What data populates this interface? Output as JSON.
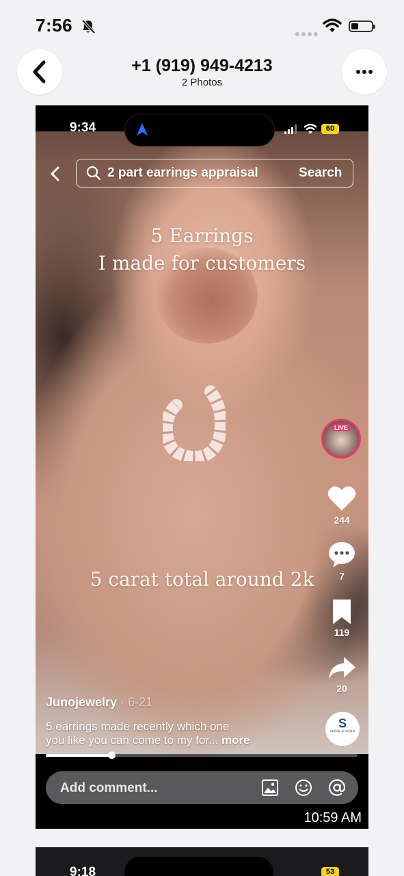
{
  "status_bar": {
    "time": "7:56",
    "bell_icon": "bell-slash-icon",
    "wifi_icon": "wifi-icon",
    "battery_icon": "battery-icon"
  },
  "header": {
    "title": "+1 (919) 949-4213",
    "subtitle": "2 Photos",
    "back_icon": "chevron-left-icon",
    "more_icon": "ellipsis-icon"
  },
  "photo": {
    "status_time": "9:34",
    "battery": "60",
    "search": {
      "query": "2 part earrings appraisal",
      "button": "Search"
    },
    "overlay": {
      "line1": "5 Earrings",
      "line2": "I made for customers",
      "line3": "5 carat total around 2k"
    },
    "live_label": "LIVE",
    "actions": [
      {
        "icon": "heart-icon",
        "count": "244"
      },
      {
        "icon": "comment-icon",
        "count": "7"
      },
      {
        "icon": "bookmark-icon",
        "count": "119"
      },
      {
        "icon": "share-icon",
        "count": "20"
      }
    ],
    "author": "Junojewelry",
    "date": " · 6-21",
    "description_line1": "5 earrings made recently which one",
    "description_line2": "you like you can come to my for...",
    "more": " more",
    "brand_logo": {
      "letter": "S",
      "text": "score a score"
    },
    "progress": 0.21,
    "comment_placeholder": "Add comment...",
    "timestamp": "10:59 AM",
    "accent_color": "#f0326a"
  },
  "next_photo": {
    "status_time": "9:18",
    "battery": "53"
  }
}
